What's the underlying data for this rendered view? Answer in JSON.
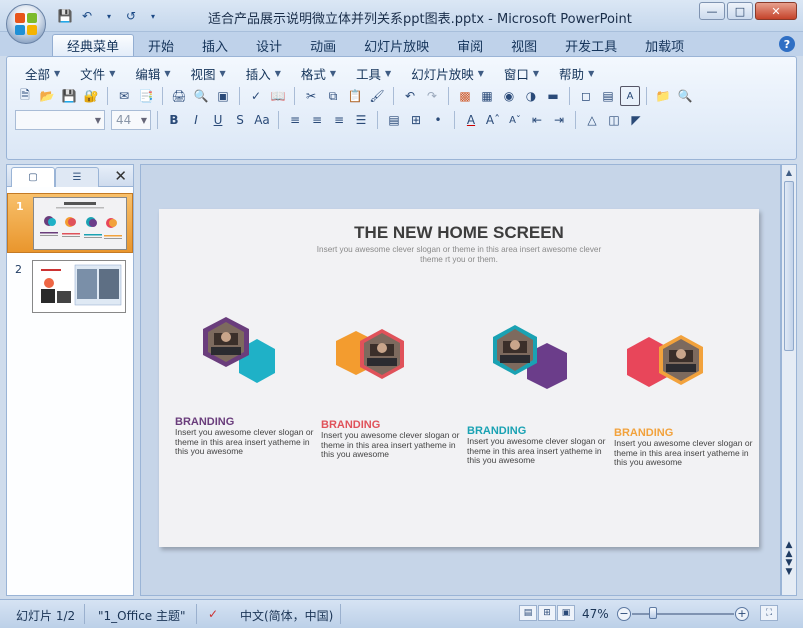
{
  "window": {
    "title": "适合产品展示说明微立体并列关系ppt图表.pptx - Microsoft PowerPoint",
    "controls": [
      "minimize",
      "maximize",
      "close"
    ]
  },
  "quick_access": [
    "save-icon",
    "undo-icon",
    "redo-icon",
    "customize-icon"
  ],
  "ribbon_tabs": [
    "经典菜单",
    "开始",
    "插入",
    "设计",
    "动画",
    "幻灯片放映",
    "审阅",
    "视图",
    "开发工具",
    "加载项"
  ],
  "active_tab": "经典菜单",
  "classic_menu": [
    {
      "label": "全部"
    },
    {
      "label": "文件"
    },
    {
      "label": "编辑"
    },
    {
      "label": "视图"
    },
    {
      "label": "插入"
    },
    {
      "label": "格式"
    },
    {
      "label": "工具"
    },
    {
      "label": "幻灯片放映"
    },
    {
      "label": "窗口"
    },
    {
      "label": "帮助"
    }
  ],
  "font_controls": {
    "font_name": "",
    "font_size": "44"
  },
  "thumbnails": [
    {
      "number": "1",
      "selected": true
    },
    {
      "number": "2",
      "selected": false
    }
  ],
  "slide": {
    "title": "THE NEW HOME SCREEN",
    "subtitle": "Insert you awesome clever slogan or theme in this area insert awesome clever theme rt you or them.",
    "cards": [
      {
        "heading": "BRANDING",
        "body": "Insert you awesome clever slogan or theme in this area insert yatheme in this you awesome",
        "color": "#6a3d7c",
        "accent": "#1fb1c7"
      },
      {
        "heading": "BRANDING",
        "body": "Insert you awesome clever slogan or theme in this area insert yatheme in this you awesome",
        "color": "#e0525a",
        "accent": "#f39c2f"
      },
      {
        "heading": "BRANDING",
        "body": "Insert you awesome clever slogan or theme in this area insert yatheme in this you awesome",
        "color": "#1aa2b3",
        "accent": "#6b3d8a"
      },
      {
        "heading": "BRANDING",
        "body": "Insert you awesome clever slogan or theme in this area insert yatheme in this you awesome",
        "color": "#f2a23c",
        "accent": "#e8465a"
      }
    ]
  },
  "status": {
    "slide_counter": "幻灯片 1/2",
    "theme": "\"1_Office 主题\"",
    "language": "中文(简体，中国)",
    "zoom": "47%",
    "zoom_level": 0.47
  }
}
